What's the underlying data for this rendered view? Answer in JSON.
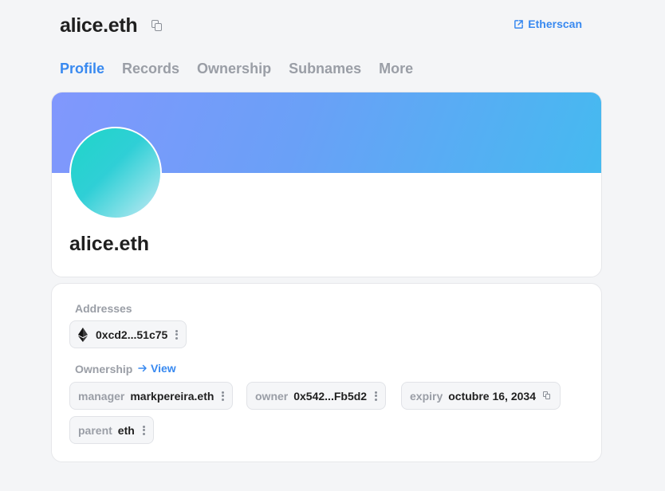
{
  "header": {
    "title": "alice.eth",
    "etherscan_label": "Etherscan"
  },
  "tabs": [
    {
      "label": "Profile",
      "active": true
    },
    {
      "label": "Records",
      "active": false
    },
    {
      "label": "Ownership",
      "active": false
    },
    {
      "label": "Subnames",
      "active": false
    },
    {
      "label": "More",
      "active": false
    }
  ],
  "profile": {
    "name": "alice.eth"
  },
  "addresses": {
    "label": "Addresses",
    "items": [
      {
        "icon": "ethereum-icon",
        "value": "0xcd2...51c75"
      }
    ]
  },
  "ownership": {
    "label": "Ownership",
    "view_label": "View",
    "items": [
      {
        "key": "manager",
        "value": "markpereira.eth"
      },
      {
        "key": "owner",
        "value": "0x542...Fb5d2"
      },
      {
        "key": "expiry",
        "value": "octubre 16, 2034"
      },
      {
        "key": "parent",
        "value": "eth"
      }
    ]
  },
  "colors": {
    "accent": "#3889f0",
    "banner_start": "#8197fd",
    "banner_end": "#45baf0",
    "avatar_start": "#1fd6c8",
    "avatar_end": "#c9e8f5"
  }
}
